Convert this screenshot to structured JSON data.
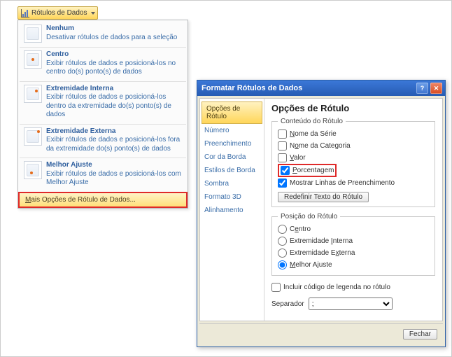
{
  "dropdown": {
    "button_label": "Rótulos de Dados"
  },
  "menu": {
    "items": [
      {
        "title": "Nenhum",
        "desc": "Desativar rótulos de dados para a seleção"
      },
      {
        "title": "Centro",
        "desc": "Exibir rótulos de dados e posicioná-los no centro do(s) ponto(s) de dados"
      },
      {
        "title": "Extremidade Interna",
        "desc": "Exibir rótulos de dados e posicioná-los dentro da extremidade do(s) ponto(s) de dados"
      },
      {
        "title": "Extremidade Externa",
        "desc": "Exibir rótulos de dados e posicioná-los fora da extremidade do(s) ponto(s) de dados"
      },
      {
        "title": "Melhor Ajuste",
        "desc": "Exibir rótulos de dados e posicioná-los com Melhor Ajuste"
      }
    ],
    "more": "Mais Opções de Rótulo de Dados..."
  },
  "dialog": {
    "title": "Formatar Rótulos de Dados",
    "nav": [
      "Opções de Rótulo",
      "Número",
      "Preenchimento",
      "Cor da Borda",
      "Estilos de Borda",
      "Sombra",
      "Formato 3D",
      "Alinhamento"
    ],
    "pane": {
      "heading": "Opções de Rótulo",
      "group_conteudo": {
        "legend": "Conteúdo do Rótulo",
        "opts": [
          {
            "label": "Nome da Série",
            "checked": false
          },
          {
            "label": "Nome da Categoria",
            "checked": false
          },
          {
            "label": "Valor",
            "checked": false
          },
          {
            "label": "Porcentagem",
            "checked": true,
            "highlight": true
          },
          {
            "label": "Mostrar Linhas de Preenchimento",
            "checked": true
          }
        ],
        "reset_btn": "Redefinir Texto do Rótulo"
      },
      "group_posicao": {
        "legend": "Posição do Rótulo",
        "opts": [
          {
            "label": "Centro",
            "selected": false
          },
          {
            "label": "Extremidade Interna",
            "selected": false
          },
          {
            "label": "Extremidade Externa",
            "selected": false
          },
          {
            "label": "Melhor Ajuste",
            "selected": true
          }
        ]
      },
      "include_legend": {
        "label": "Incluir código de legenda no rótulo",
        "checked": false
      },
      "separator": {
        "label": "Separador",
        "value": ";"
      }
    },
    "close_btn": "Fechar"
  }
}
